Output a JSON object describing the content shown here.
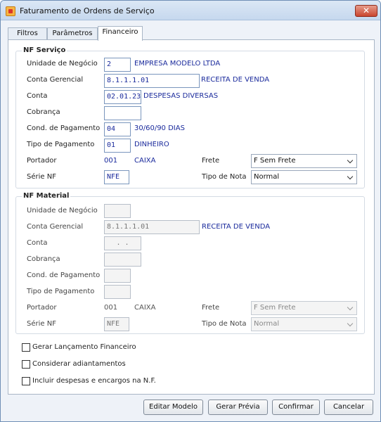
{
  "window": {
    "title": "Faturamento de Ordens de Serviço",
    "close_label": "✕"
  },
  "tabs": [
    {
      "label": "Filtros"
    },
    {
      "label": "Parâmetros"
    },
    {
      "label": "Financeiro"
    }
  ],
  "nf_servico": {
    "title": "NF Serviço",
    "unidade": {
      "label": "Unidade de Negócio",
      "value": "2",
      "desc": "EMPRESA MODELO LTDA"
    },
    "conta_gerencial": {
      "label": "Conta Gerencial",
      "value": "8.1.1.1.01",
      "desc": "RECEITA DE VENDA"
    },
    "conta": {
      "label": "Conta",
      "value": "02.01.23",
      "desc": "DESPESAS DIVERSAS"
    },
    "cobranca": {
      "label": "Cobrança",
      "value": ""
    },
    "cond_pagamento": {
      "label": "Cond. de Pagamento",
      "value": "04",
      "desc": "30/60/90 DIAS"
    },
    "tipo_pagamento": {
      "label": "Tipo de Pagamento",
      "value": "01",
      "desc": "DINHEIRO"
    },
    "portador": {
      "label": "Portador",
      "code": "001",
      "desc": "CAIXA"
    },
    "frete": {
      "label": "Frete",
      "value": "F Sem Frete"
    },
    "serie": {
      "label": "Série NF",
      "value": "NFE"
    },
    "tipo_nota": {
      "label": "Tipo de Nota",
      "value": "Normal"
    }
  },
  "nf_material": {
    "title": "NF Material",
    "unidade": {
      "label": "Unidade de Negócio",
      "value": ""
    },
    "conta_gerencial": {
      "label": "Conta Gerencial",
      "value": "8.1.1.1.01",
      "desc": "RECEITA DE VENDA"
    },
    "conta": {
      "label": "Conta",
      "value": ". ."
    },
    "cobranca": {
      "label": "Cobrança",
      "value": ""
    },
    "cond_pagamento": {
      "label": "Cond. de Pagamento",
      "value": ""
    },
    "tipo_pagamento": {
      "label": "Tipo de Pagamento",
      "value": ""
    },
    "portador": {
      "label": "Portador",
      "code": "001",
      "desc": "CAIXA"
    },
    "frete": {
      "label": "Frete",
      "value": "F Sem Frete"
    },
    "serie": {
      "label": "Série NF",
      "value": "NFE"
    },
    "tipo_nota": {
      "label": "Tipo de Nota",
      "value": "Normal"
    }
  },
  "options": [
    {
      "label": "Gerar Lançamento Financeiro",
      "checked": false
    },
    {
      "label": "Considerar adiantamentos",
      "checked": false
    },
    {
      "label": "Incluir despesas e encargos na N.F.",
      "checked": false
    }
  ],
  "buttons": {
    "editar": "Editar Modelo",
    "gerar": "Gerar Prévia",
    "confirmar": "Confirmar",
    "cancelar": "Cancelar"
  }
}
